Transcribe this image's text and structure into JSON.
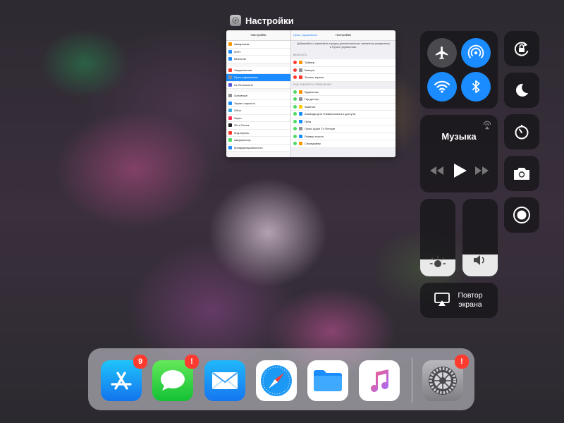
{
  "preview": {
    "app_title": "Настройки",
    "left_header": "Настройки",
    "left_items": [
      {
        "label": "Авиарежим",
        "color": "#ff9500"
      },
      {
        "label": "Wi-Fi",
        "color": "#1a8cff"
      },
      {
        "label": "Bluetooth",
        "color": "#1a8cff"
      },
      {
        "label": "Уведомления",
        "color": "#ff3b30"
      },
      {
        "label": "Пункт управления",
        "color": "#8e8e93",
        "selected": true
      },
      {
        "label": "Не беспокоить",
        "color": "#5856d6"
      },
      {
        "label": "Основные",
        "color": "#8e8e93"
      },
      {
        "label": "Экран и яркость",
        "color": "#1a8cff"
      },
      {
        "label": "Обои",
        "color": "#34aadc"
      },
      {
        "label": "Звуки",
        "color": "#ff2d55"
      },
      {
        "label": "Siri и Поиск",
        "color": "#222222"
      },
      {
        "label": "Код-пароль",
        "color": "#ff3b30"
      },
      {
        "label": "Аккумулятор",
        "color": "#4cd964"
      },
      {
        "label": "Конфиденциальность",
        "color": "#1a8cff"
      }
    ],
    "right_back": "Пункт управления",
    "right_header": "Настройки",
    "right_desc": "Добавляйте и изменяйте порядок дополнительных элементов управления в Пункте управления.",
    "section_include": "ВКЛЮЧИТЬ",
    "included": [
      {
        "label": "Таймер",
        "color": "#ff9500"
      },
      {
        "label": "Камера",
        "color": "#8e8e93"
      },
      {
        "label": "Запись экрана",
        "color": "#ff3b30"
      }
    ],
    "section_more": "ЕЩЕ ЭЛЕМЕНТЫ УПРАВЛЕНИЯ",
    "more": [
      {
        "label": "Будильник",
        "color": "#ff9500"
      },
      {
        "label": "Гид-доступ",
        "color": "#8e8e93"
      },
      {
        "label": "Заметки",
        "color": "#ffcc00"
      },
      {
        "label": "Команды для Универсального доступа",
        "color": "#1a8cff"
      },
      {
        "label": "Лупа",
        "color": "#1a8cff"
      },
      {
        "label": "Пульт Apple TV Remote",
        "color": "#8e8e93"
      },
      {
        "label": "Размер текста",
        "color": "#1a8cff"
      },
      {
        "label": "Секундомер",
        "color": "#ff9500"
      }
    ]
  },
  "control_center": {
    "music_title": "Музыка",
    "mirror_label_1": "Повтор",
    "mirror_label_2": "экрана",
    "brightness_level": 0.22,
    "volume_level": 0.28,
    "accent": "#1a8cff",
    "toggles": [
      {
        "icon": "airplane-icon",
        "active": false
      },
      {
        "icon": "airdrop-icon",
        "active": true
      },
      {
        "icon": "wifi-icon",
        "active": true
      },
      {
        "icon": "bluetooth-icon",
        "active": true
      }
    ]
  },
  "dock": {
    "app_store_badge": "9",
    "messages_badge": "!",
    "settings_badge": "!",
    "apps": [
      "app-store",
      "messages",
      "mail",
      "safari",
      "files",
      "music",
      "settings"
    ]
  }
}
